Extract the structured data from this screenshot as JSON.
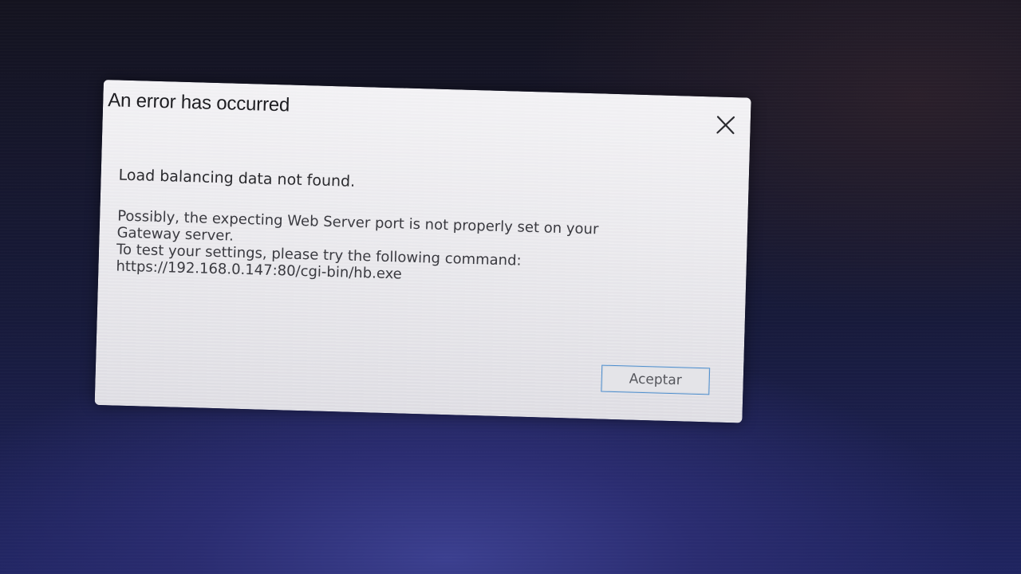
{
  "dialog": {
    "title": "An error has occurred",
    "close_icon": "close-icon",
    "heading": "Load balancing data not found.",
    "body_lines": [
      "Possibly, the expecting Web Server port is not properly set on your",
      "Gateway server.",
      "To test your settings, please try the following command:",
      "https://192.168.0.147:80/cgi-bin/hb.exe"
    ],
    "ok_label": "Aceptar"
  },
  "colors": {
    "accent_border": "#4f8fce",
    "dialog_bg": "#e9e8ec",
    "desktop_bg": "#1f2460"
  }
}
